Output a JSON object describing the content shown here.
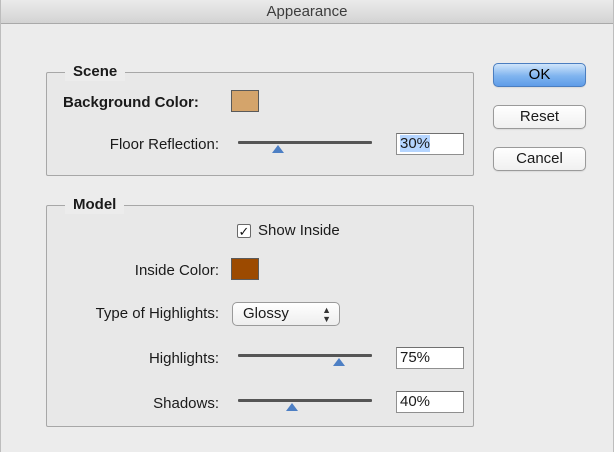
{
  "window": {
    "title": "Appearance"
  },
  "scene": {
    "title": "Scene",
    "background_color_label": "Background Color:",
    "background_color": "#d4a46b",
    "floor_reflection_label": "Floor Reflection:",
    "floor_reflection_value": "30%",
    "floor_reflection_level": 0.3
  },
  "model": {
    "title": "Model",
    "show_inside_label": "Show Inside",
    "show_inside_checked": true,
    "inside_color_label": "Inside Color:",
    "inside_color": "#9c4a00",
    "highlights_type_label": "Type of Highlights:",
    "highlights_type_value": "Glossy",
    "highlights_label": "Highlights:",
    "highlights_value": "75%",
    "highlights_level": 0.75,
    "shadows_label": "Shadows:",
    "shadows_value": "40%",
    "shadows_level": 0.4
  },
  "buttons": {
    "ok": "OK",
    "reset": "Reset",
    "cancel": "Cancel"
  },
  "colors": {
    "accent": "#5f9ce8",
    "slider_thumb": "#4d7fc4"
  }
}
